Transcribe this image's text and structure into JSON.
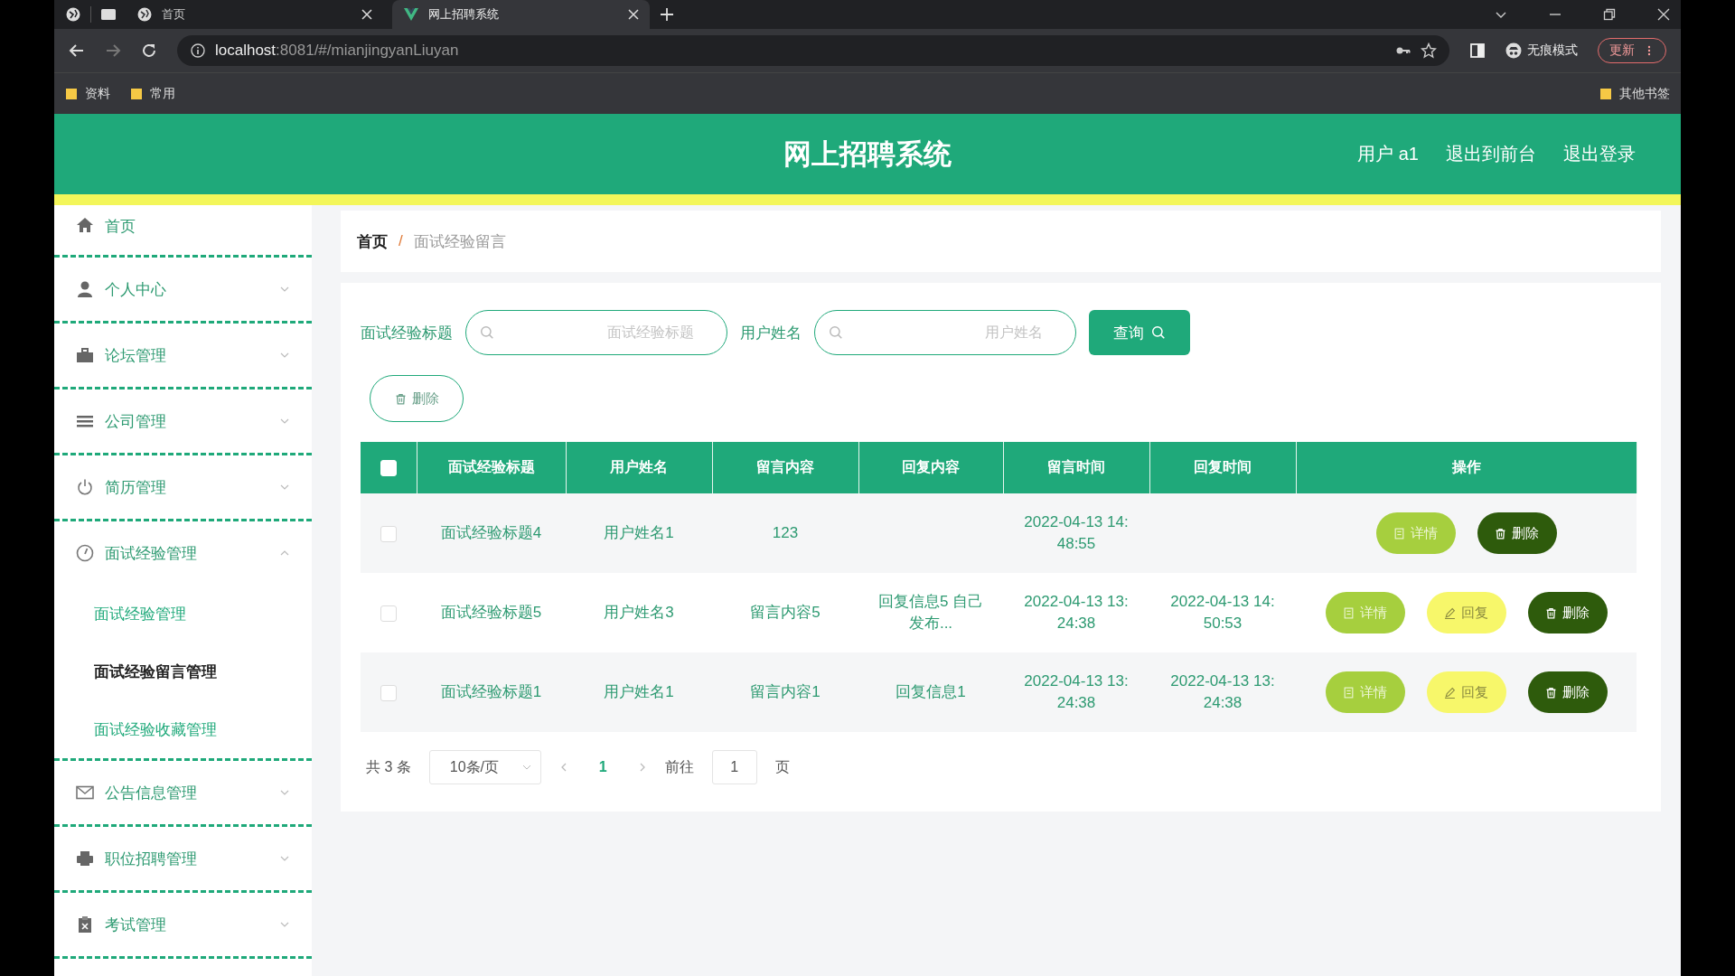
{
  "browser": {
    "tabs": [
      {
        "title": "首页",
        "selected": false
      },
      {
        "title": "网上招聘系统",
        "selected": true
      }
    ],
    "address": {
      "host": "localhost",
      "path": ":8081/#/mianjingyanLiuyan"
    },
    "mode_label": "无痕模式",
    "update_button": "更新",
    "bookmarks": [
      "资料",
      "常用"
    ],
    "other_bookmarks": "其他书签"
  },
  "header": {
    "title": "网上招聘系统",
    "links": [
      "用户 a1",
      "退出到前台",
      "退出登录"
    ]
  },
  "sidebar": {
    "items": [
      {
        "label": "首页",
        "kind": "link"
      },
      {
        "label": "个人中心",
        "kind": "menu",
        "expanded": false
      },
      {
        "label": "论坛管理",
        "kind": "menu",
        "expanded": false
      },
      {
        "label": "公司管理",
        "kind": "menu",
        "expanded": false
      },
      {
        "label": "简历管理",
        "kind": "menu",
        "expanded": false
      },
      {
        "label": "面试经验管理",
        "kind": "menu",
        "expanded": true,
        "children": [
          {
            "label": "面试经验管理",
            "selected": false
          },
          {
            "label": "面试经验留言管理",
            "selected": true
          },
          {
            "label": "面试经验收藏管理",
            "selected": false
          }
        ]
      },
      {
        "label": "公告信息管理",
        "kind": "menu",
        "expanded": false
      },
      {
        "label": "职位招聘管理",
        "kind": "menu",
        "expanded": false
      },
      {
        "label": "考试管理",
        "kind": "menu",
        "expanded": false
      }
    ]
  },
  "breadcrumb": {
    "items": [
      "首页",
      "面试经验留言"
    ],
    "separator": "/"
  },
  "search": {
    "fields": [
      {
        "label": "面试经验标题",
        "placeholder": "面试经验标题"
      },
      {
        "label": "用户姓名",
        "placeholder": "用户姓名"
      }
    ],
    "button": "查询"
  },
  "bulk_delete": "删除",
  "table": {
    "header_checked": false,
    "columns": [
      "面试经验标题",
      "用户姓名",
      "留言内容",
      "回复内容",
      "留言时间",
      "回复时间",
      "操作"
    ],
    "rows": [
      {
        "checked": false,
        "cells": [
          "面试经验标题4",
          "用户姓名1",
          "123",
          "",
          "2022-04-13 14:48:55",
          ""
        ],
        "actions": [
          {
            "kind": "detail",
            "label": "详情"
          },
          {
            "kind": "delete",
            "label": "删除"
          }
        ]
      },
      {
        "checked": false,
        "cells": [
          "面试经验标题5",
          "用户姓名3",
          "留言内容5",
          "回复信息5 自己发布...",
          "2022-04-13 13:24:38",
          "2022-04-13 14:50:53"
        ],
        "actions": [
          {
            "kind": "detail",
            "label": "详情"
          },
          {
            "kind": "reply",
            "label": "回复"
          },
          {
            "kind": "delete",
            "label": "删除"
          }
        ]
      },
      {
        "checked": false,
        "cells": [
          "面试经验标题1",
          "用户姓名1",
          "留言内容1",
          "回复信息1",
          "2022-04-13 13:24:38",
          "2022-04-13 13:24:38"
        ],
        "actions": [
          {
            "kind": "detail",
            "label": "详情"
          },
          {
            "kind": "reply",
            "label": "回复"
          },
          {
            "kind": "delete",
            "label": "删除"
          }
        ]
      }
    ]
  },
  "pagination": {
    "total": "共 3 条",
    "page_size": "10条/页",
    "pages": [
      {
        "label": "1",
        "selected": true
      }
    ],
    "goto_label": "前往",
    "goto_value": "1",
    "page_suffix": "页"
  }
}
